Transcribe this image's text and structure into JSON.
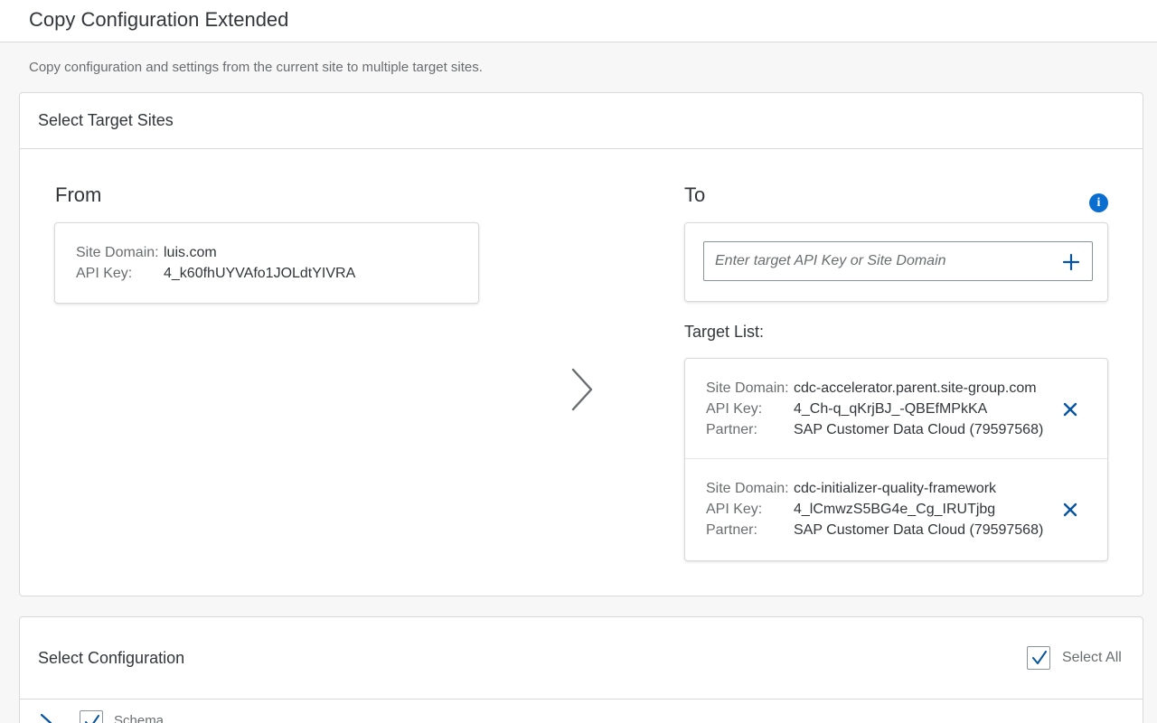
{
  "header": {
    "title": "Copy Configuration Extended"
  },
  "subtitle": "Copy configuration and settings from the current site to multiple target sites.",
  "targets_card": {
    "title": "Select Target Sites",
    "from": {
      "title": "From",
      "site_domain_label": "Site Domain:",
      "site_domain": "luis.com",
      "api_key_label": "API Key:",
      "api_key": "4_k60fhUYVAfo1JOLdtYIVRA"
    },
    "to": {
      "title": "To",
      "input_placeholder": "Enter target API Key or Site Domain",
      "input_value": "",
      "target_list_label": "Target List:",
      "targets": [
        {
          "site_domain_label": "Site Domain:",
          "site_domain": "cdc-accelerator.parent.site-group.com",
          "api_key_label": "API Key:",
          "api_key": "4_Ch-q_qKrjBJ_-QBEfMPkKA",
          "partner_label": "Partner:",
          "partner": "SAP Customer Data Cloud (79597568)"
        },
        {
          "site_domain_label": "Site Domain:",
          "site_domain": "cdc-initializer-quality-framework",
          "api_key_label": "API Key:",
          "api_key": "4_lCmwzS5BG4e_Cg_IRUTjbg",
          "partner_label": "Partner:",
          "partner": "SAP Customer Data Cloud (79597568)"
        }
      ]
    }
  },
  "config_card": {
    "title": "Select Configuration",
    "select_all_label": "Select All",
    "select_all_checked": true,
    "items": [
      {
        "label": "Schema",
        "checked": true
      }
    ]
  },
  "icons": {
    "arrow": "chevron-right-icon",
    "info": "info-icon",
    "add": "plus-icon",
    "remove": "close-icon",
    "check": "checkmark-icon",
    "expand": "chevron-right-icon"
  },
  "colors": {
    "accent": "#0a6ed1",
    "icon_blue": "#0854a0",
    "text": "#32363a",
    "muted_text": "#6a6d70",
    "border": "#d9d9d9",
    "background": "#f7f7f7"
  }
}
